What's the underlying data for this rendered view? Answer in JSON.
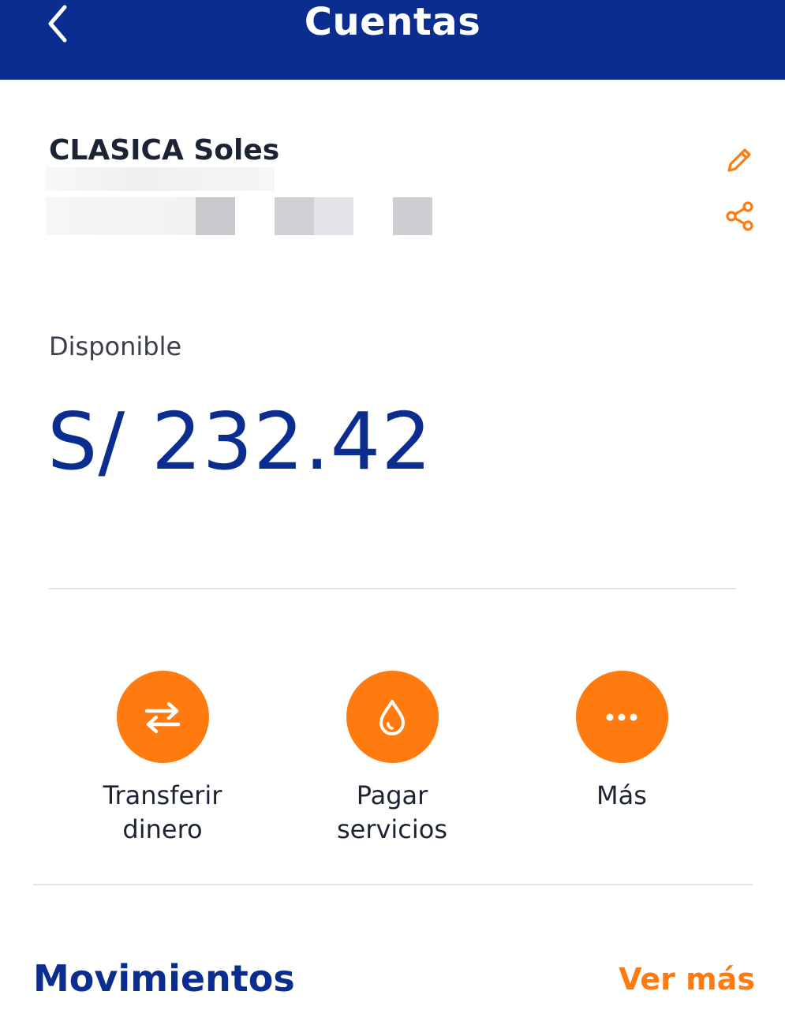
{
  "header": {
    "title": "Cuentas",
    "back_icon": "chevron-left-icon",
    "background_color": "#0a2d8f"
  },
  "account": {
    "name": "CLASICA Soles",
    "edit_icon": "pencil-icon",
    "share_icon": "share-icon"
  },
  "balance": {
    "label": "Disponible",
    "amount": "S/ 232.42"
  },
  "actions": [
    {
      "label": "Transferir\ndinero",
      "icon": "transfer-arrows-icon"
    },
    {
      "label": "Pagar\nservicios",
      "icon": "drop-icon"
    },
    {
      "label": "Más",
      "icon": "more-dots-icon"
    }
  ],
  "movements": {
    "title": "Movimientos",
    "see_more": "Ver más"
  },
  "colors": {
    "primary": "#0a2d8f",
    "accent": "#ff7a0f"
  }
}
